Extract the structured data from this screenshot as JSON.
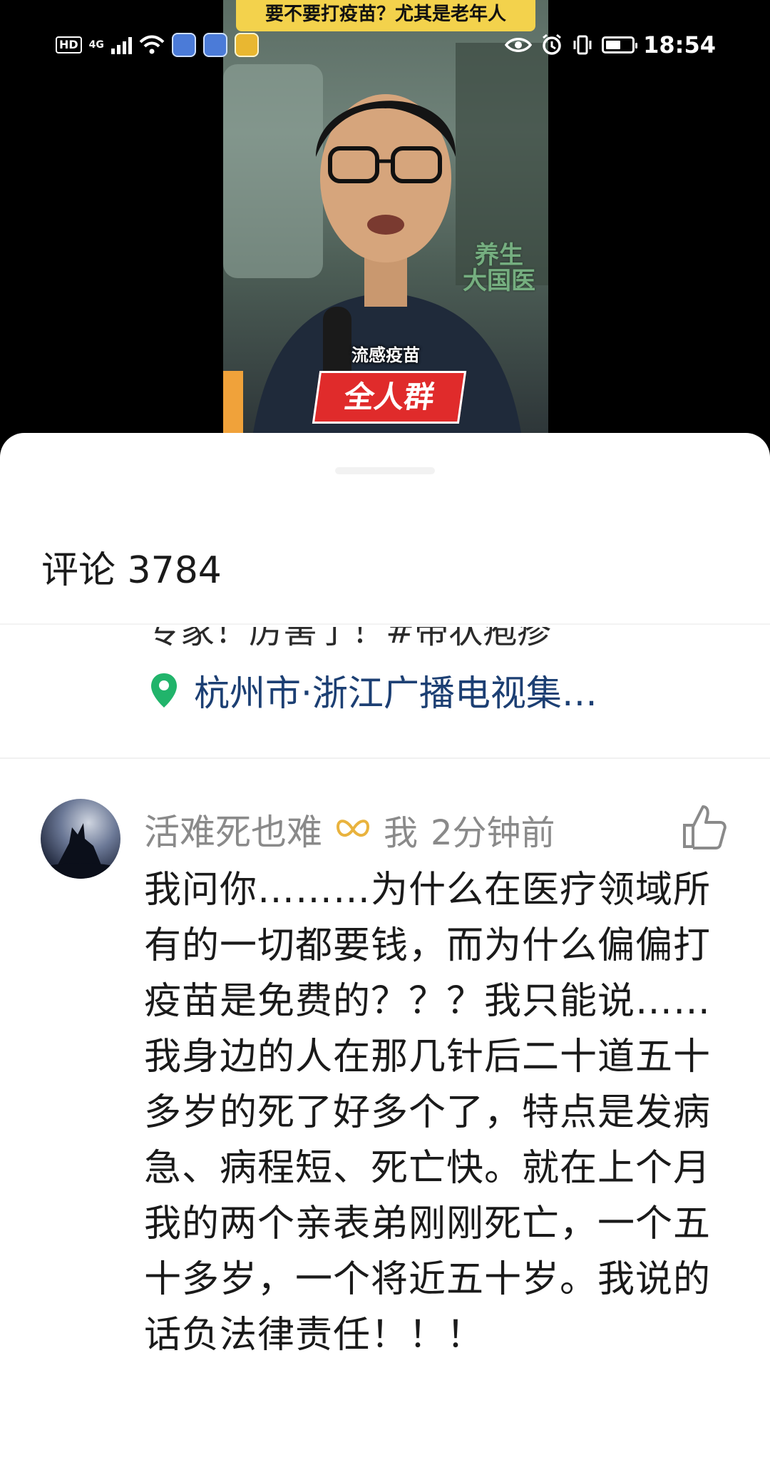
{
  "video": {
    "title_banner": "要不要打疫苗？尤其是老年人",
    "caption_small": "流感疫苗",
    "caption_tag": "全人群",
    "watermark": "养生\n大国医"
  },
  "status_bar": {
    "hd": "HD",
    "network": "4G",
    "time": "18:54"
  },
  "comments": {
    "title": "评论 3784",
    "cut_off_text": "专家！厉害了！#带状疱疹",
    "location": "杭州市·浙江广播电视集…",
    "items": [
      {
        "username": "活难死也难",
        "me_tag": "我",
        "time": "2分钟前",
        "text": "我问你………为什么在医疗领域所有的一切都要钱，而为什么偏偏打疫苗是免费的？？？我只能说……我身边的人在那几针后二十道五十多岁的死了好多个了，特点是发病急、病程短、死亡快。就在上个月我的两个亲表弟刚刚死亡，一个五十多岁，一个将近五十岁。我说的话负法律责任！！！"
      }
    ]
  },
  "colors": {
    "accent_location": "#21b46b",
    "location_text": "#1c3f73",
    "muted_text": "#8a8a8a"
  }
}
